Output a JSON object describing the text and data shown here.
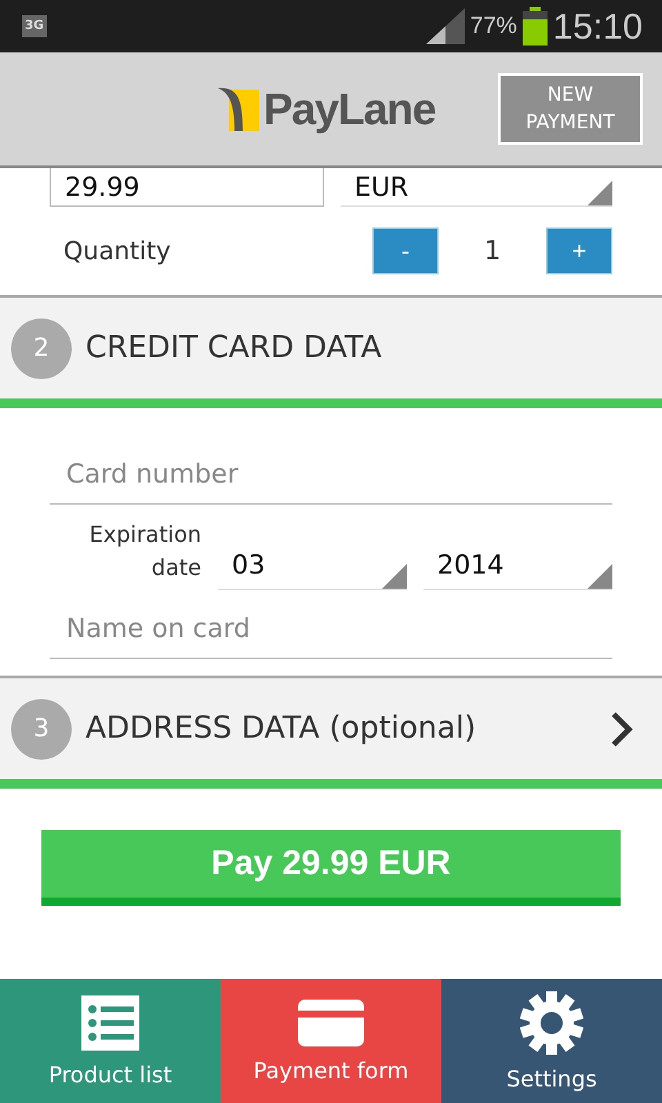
{
  "status_bar": {
    "network": "3G",
    "battery_percent": "77%",
    "time": "15:10"
  },
  "header": {
    "logo": "PayLane",
    "button": "NEW PAYMENT"
  },
  "amount": {
    "value": "29.99",
    "currency": "EUR"
  },
  "quantity": {
    "label": "Quantity",
    "minus": "-",
    "value": "1",
    "plus": "+"
  },
  "credit_card_section": {
    "number": "2",
    "title": "CREDIT CARD DATA",
    "expanded": true
  },
  "card_form": {
    "card_number": {
      "placeholder": "Card number"
    },
    "expiration_label": "Expiration date",
    "month": "03",
    "year": "2014",
    "name_on_card": {
      "placeholder": "Name on card"
    }
  },
  "address_section": {
    "number": "3",
    "title": "ADDRESS DATA (optional)",
    "expanded": false
  },
  "pay_button": "Pay 29.99 EUR",
  "bottom_nav": [
    {
      "label": "Product list",
      "kind": "list",
      "color": "#2e967a"
    },
    {
      "label": "Payment form",
      "kind": "card",
      "color": "#e84545"
    },
    {
      "label": "Settings",
      "kind": "gear",
      "color": "#365673"
    }
  ]
}
